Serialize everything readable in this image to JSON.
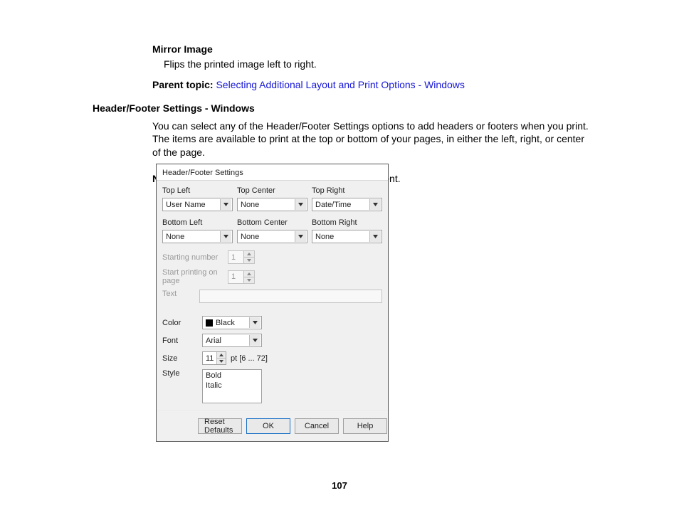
{
  "doc": {
    "mirror_title": "Mirror Image",
    "mirror_desc": "Flips the printed image left to right.",
    "parent_topic_label": "Parent topic: ",
    "parent_topic_link": "Selecting Additional Layout and Print Options - Windows",
    "section_heading": "Header/Footer Settings - Windows",
    "section_body": "You can select any of the Header/Footer Settings options to add headers or footers when you print. The items are available to print at the top or bottom of your pages, in either the left, right, or center of the page.",
    "note_label": "Note: ",
    "note_text": "These settings are not saved with your document.",
    "page_number": "107"
  },
  "dialog": {
    "title": "Header/Footer Settings",
    "positions": {
      "top_left": {
        "label": "Top Left",
        "value": "User Name"
      },
      "top_center": {
        "label": "Top Center",
        "value": "None"
      },
      "top_right": {
        "label": "Top Right",
        "value": "Date/Time"
      },
      "bottom_left": {
        "label": "Bottom Left",
        "value": "None"
      },
      "bottom_center": {
        "label": "Bottom Center",
        "value": "None"
      },
      "bottom_right": {
        "label": "Bottom Right",
        "value": "None"
      }
    },
    "starting_number_label": "Starting number",
    "starting_number_value": "1",
    "start_printing_label": "Start printing on page",
    "start_printing_value": "1",
    "text_label": "Text",
    "text_value": "",
    "color_label": "Color",
    "color_value": "Black",
    "font_label": "Font",
    "font_value": "Arial",
    "size_label": "Size",
    "size_value": "11",
    "size_unit": "pt  [6 ... 72]",
    "style_label": "Style",
    "style_options": [
      "Bold",
      "Italic"
    ],
    "buttons": {
      "reset": "Reset Defaults",
      "ok": "OK",
      "cancel": "Cancel",
      "help": "Help"
    }
  }
}
